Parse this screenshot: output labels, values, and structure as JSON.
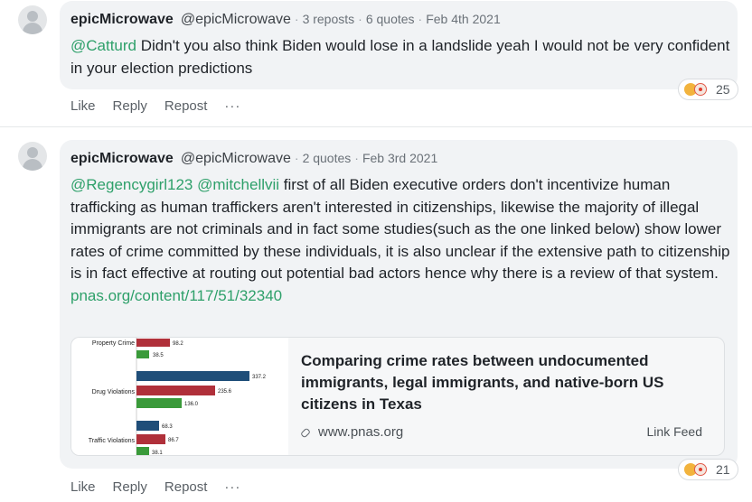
{
  "posts": [
    {
      "author": "epicMicrowave",
      "handle": "@epicMicrowave",
      "reposts": "3 reposts",
      "quotes": "6 quotes",
      "date": "Feb 4th 2021",
      "mention1": "@Catturd",
      "text": "Didn't you also think Biden would lose in a landslide yeah I would not be very confident in your election predictions",
      "reaction_count": "25"
    },
    {
      "author": "epicMicrowave",
      "handle": "@epicMicrowave",
      "quotes": "2 quotes",
      "date": "Feb 3rd 2021",
      "mention1": "@Regencygirl123",
      "mention2": "@mitchellvii",
      "text": "first of all Biden executive orders don't incentivize human trafficking as human traffickers aren't interested in citizenships, likewise the majority of illegal immigrants are not criminals and in fact some studies(such as the one linked below) show lower rates of crime committed by these individuals, it is also unclear if the extensive path to citizenship is in fact effective at routing out potential bad actors hence why there is a review of that system.",
      "link": "pnas.org/content/117/51/32340",
      "card": {
        "title": "Comparing crime rates between undocumented immigrants, legal immigrants, and native-born US citizens in Texas",
        "domain": "www.pnas.org",
        "feed_label": "Link Feed"
      },
      "reaction_count": "21"
    }
  ],
  "actions": {
    "like": "Like",
    "reply": "Reply",
    "repost": "Repost",
    "more": "···"
  },
  "thumbnail": {
    "categories": [
      "Property Crime",
      "Drug Violations",
      "Traffic Violations"
    ],
    "bars": [
      {
        "category": "Property Crime",
        "values": [
          "98.2",
          "38.5"
        ]
      },
      {
        "category": "Drug Violations",
        "values": [
          "337.2",
          "235.6",
          "136.0"
        ]
      },
      {
        "category": "Traffic Violations",
        "values": [
          "68.3",
          "86.7",
          "38.1"
        ]
      }
    ]
  },
  "colors": {
    "accent": "#2ea06a",
    "bubble": "#f1f3f5",
    "bar_blue": "#1f4e79",
    "bar_red": "#b0303a",
    "bar_green": "#3a9a3a"
  }
}
